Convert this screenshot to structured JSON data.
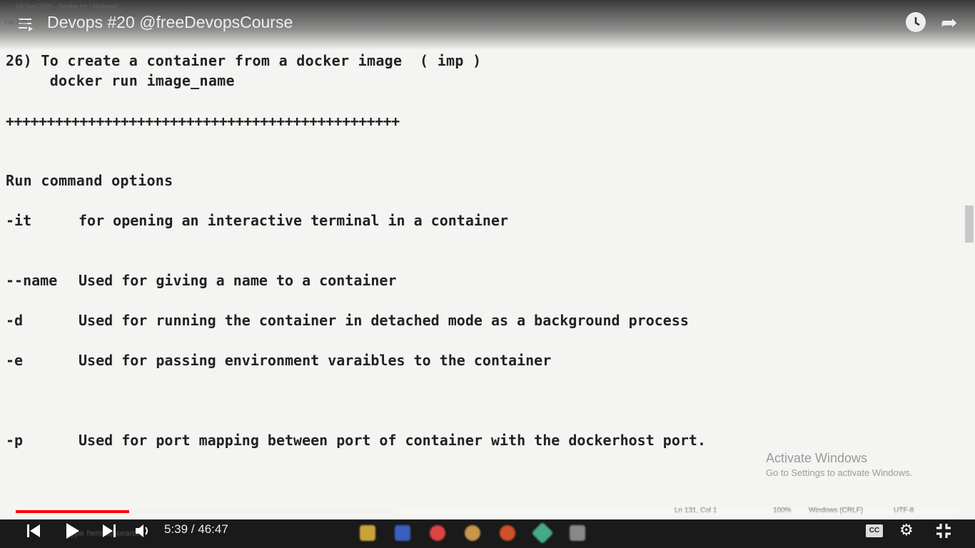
{
  "player": {
    "title": "Devops #20 @freeDevopsCourse",
    "current_time": "5:39",
    "duration": "46:47",
    "time_display": "5:39 / 46:47",
    "progress_percent": 12,
    "buffered_percent": 40,
    "accent": "#ff0000"
  },
  "notepad": {
    "window_title": "03-Sep-2020 - Docker.txt - Notepad",
    "menu": "File  Edit",
    "lines": [
      "26) To create a container from a docker image  ( imp )",
      "     docker run image_name",
      "++++++++++++++++++++++++++++++++++++++++++++++++",
      "Run command options"
    ],
    "options": [
      {
        "flag": "-it",
        "desc": "for opening an interactive terminal in a container"
      },
      {
        "flag": "--name",
        "desc": "Used for giving a name to a container"
      },
      {
        "flag": "-d",
        "desc": "Used for running the container in detached mode as a background process"
      },
      {
        "flag": "-e",
        "desc": "Used for passing environment varaibles to the container"
      },
      {
        "flag": "-p",
        "desc": "Used for port mapping between port of container with the dockerhost port."
      }
    ],
    "status": {
      "position": "Ln 131, Col 1",
      "zoom": "100%",
      "eol": "Windows (CRLF)",
      "encoding": "UTF-8"
    }
  },
  "watermark": {
    "line1": "Activate Windows",
    "line2": "Go to Settings to activate Windows."
  },
  "taskbar": {
    "search_placeholder": "Type here to search"
  },
  "controls": {
    "cc_label": "CC"
  }
}
